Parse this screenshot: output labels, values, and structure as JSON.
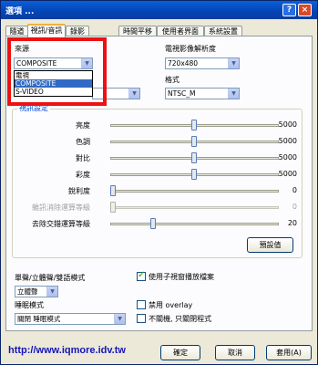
{
  "window": {
    "title": "選項 ...",
    "help_glyph": "?",
    "close_glyph": "×"
  },
  "tabs": [
    "隨道",
    "視訊/音訊",
    "錄影",
    "時間平移",
    "使用者界面",
    "系統設置"
  ],
  "active_tab": 1,
  "source": {
    "label": "來源",
    "value": "COMPOSITE",
    "options": [
      "電視",
      "COMPOSITE",
      "S-VIDEO"
    ],
    "selected_index": 1,
    "second_select_value": ""
  },
  "resolution": {
    "label": "電視影像解析度",
    "value": "720x480"
  },
  "format": {
    "label": "格式",
    "value": "NTSC_M"
  },
  "video_settings": {
    "title": "視訊設定",
    "sliders": [
      {
        "label": "亮度",
        "value": "5000",
        "level": 0.5,
        "enabled": true
      },
      {
        "label": "色調",
        "value": "5000",
        "level": 0.5,
        "enabled": true
      },
      {
        "label": "對比",
        "value": "5000",
        "level": 0.5,
        "enabled": true
      },
      {
        "label": "彩度",
        "value": "5000",
        "level": 0.5,
        "enabled": true
      },
      {
        "label": "銳利度",
        "value": "0",
        "level": 0.0,
        "enabled": true
      },
      {
        "label": "雜訊消除運算等級",
        "value": "0",
        "level": 0.0,
        "enabled": false
      },
      {
        "label": "去除交錯運算等級",
        "value": "20",
        "level": 0.25,
        "enabled": true
      }
    ],
    "default_button": "預設值"
  },
  "audio_mode": {
    "label": "單聲/立體聲/雙語模式",
    "value": "立體聲"
  },
  "sleep_mode": {
    "label": "睡眠模式",
    "value": "關閉 睡眠模式"
  },
  "checkboxes": [
    {
      "label": "使用子視窗播放檔案",
      "checked": true
    },
    {
      "label": "禁用 overlay",
      "checked": false
    },
    {
      "label": "不關機, 只關閉程式",
      "checked": false
    }
  ],
  "watermark_url": "http://www.iqmore.idv.tw",
  "buttons": {
    "ok": "確定",
    "cancel": "取消",
    "apply": "套用(A)"
  },
  "colors": {
    "title_bar": "#0a5fd8",
    "highlight": "#ee1111",
    "group_title": "#0046d5"
  }
}
